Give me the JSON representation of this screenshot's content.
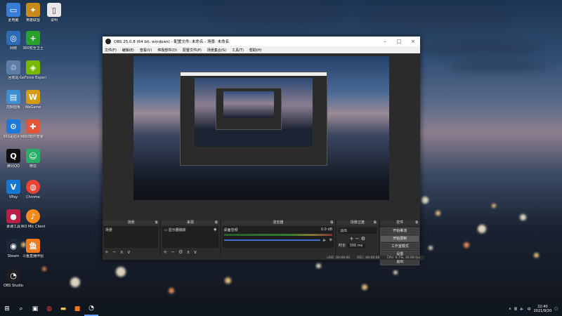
{
  "desktop_icons": [
    {
      "label": "此电脑",
      "icon": "computer-icon",
      "color": "#3a7bd5"
    },
    {
      "label": "网络",
      "icon": "network-icon",
      "color": "#2f6cb5"
    },
    {
      "label": "回收站",
      "icon": "recycle-bin-icon",
      "color": "#5d7da6"
    },
    {
      "label": "控制面板",
      "icon": "control-panel-icon",
      "color": "#3d8fd1"
    },
    {
      "label": "360驱动大师",
      "icon": "driver-icon",
      "color": "#1f78d4"
    },
    {
      "label": "腾讯QQ",
      "icon": "qq-icon",
      "color": "#111111"
    },
    {
      "label": "VPay",
      "icon": "vpay-icon",
      "color": "#1677d2"
    },
    {
      "label": "录课工具",
      "icon": "app-icon",
      "color": "#b8204a"
    },
    {
      "label": "Steam",
      "icon": "steam-icon",
      "color": "#1b2838"
    },
    {
      "label": "OBS Studio",
      "icon": "obs-icon",
      "color": "#202020"
    },
    {
      "label": "英雄联盟",
      "icon": "game-icon",
      "color": "#c98a1a"
    },
    {
      "label": "360安全卫士",
      "icon": "security-icon",
      "color": "#2ca02c"
    },
    {
      "label": "GeForce Experience",
      "icon": "nvidia-icon",
      "color": "#76b900"
    },
    {
      "label": "WeGame",
      "icon": "wegame-icon",
      "color": "#d49b16"
    },
    {
      "label": "360软件管家",
      "icon": "software-manager-icon",
      "color": "#e0563a"
    },
    {
      "label": "微信",
      "icon": "wechat-icon",
      "color": "#2aae67"
    },
    {
      "label": "Chrome",
      "icon": "chrome-icon",
      "color": "#e84335"
    },
    {
      "label": "WO Mic Client",
      "icon": "mic-icon",
      "color": "#f08a1c"
    },
    {
      "label": "斗鱼直播伴侣",
      "icon": "douyu-icon",
      "color": "#f07a1c"
    },
    {
      "label": "说明",
      "icon": "document-icon",
      "color": "#e8e8e8"
    }
  ],
  "obs": {
    "title": "OBS 25.0.8 (64 bit, windows) - 配置文件: 未命名 - 场景: 未命名",
    "menu": [
      "文件(F)",
      "编辑(E)",
      "查看(V)",
      "停靠部件(D)",
      "配置文件(P)",
      "场景集合(S)",
      "工具(T)",
      "帮助(H)"
    ],
    "docks": {
      "scenes": {
        "title": "场景",
        "item": "场景"
      },
      "sources": {
        "title": "来源",
        "item": "显示器捕获"
      },
      "mixer": {
        "title": "混音器",
        "track": "桌面音频",
        "level": "0.0 dB"
      },
      "transitions": {
        "title": "场景过渡",
        "type": "淡出",
        "duration_label": "时长",
        "duration": "300 ms"
      },
      "controls": {
        "title": "控件",
        "buttons": [
          "开始推流",
          "开始录制",
          "工作室模式",
          "设置",
          "退出"
        ]
      }
    },
    "status": {
      "live": "LIVE: 00:00:00",
      "rec": "REC: 00:00:00",
      "cpu": "CPU: 0.7%, 30.00 fps"
    }
  },
  "taskbar": {
    "time": "22:40",
    "date": "2021/9/20"
  }
}
